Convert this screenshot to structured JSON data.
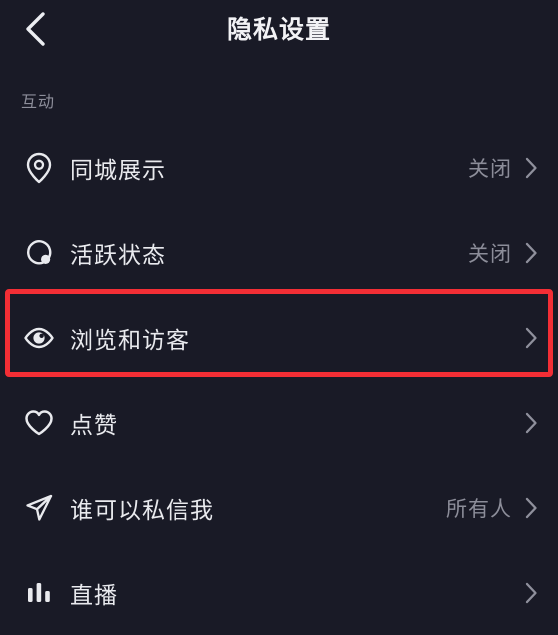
{
  "header": {
    "title": "隐私设置",
    "back_icon": "chevron-left-icon"
  },
  "section": {
    "label": "互动"
  },
  "colors": {
    "background": "#191a26",
    "label_text": "#e9eaee",
    "value_text": "#8c8d99",
    "section_text": "#8d8e9a",
    "highlight": "#f32e35"
  },
  "list": {
    "items": [
      {
        "icon": "location-pin-icon",
        "label": "同城展示",
        "value": "关闭",
        "chevron": "chevron-right-icon",
        "highlighted": false
      },
      {
        "icon": "active-status-icon",
        "label": "活跃状态",
        "value": "关闭",
        "chevron": "chevron-right-icon",
        "highlighted": false
      },
      {
        "icon": "eye-icon",
        "label": "浏览和访客",
        "value": "",
        "chevron": "chevron-right-icon",
        "highlighted": true
      },
      {
        "icon": "heart-icon",
        "label": "点赞",
        "value": "",
        "chevron": "chevron-right-icon",
        "highlighted": false
      },
      {
        "icon": "paper-plane-icon",
        "label": "谁可以私信我",
        "value": "所有人",
        "chevron": "chevron-right-icon",
        "highlighted": false
      },
      {
        "icon": "live-bars-icon",
        "label": "直播",
        "value": "",
        "chevron": "chevron-right-icon",
        "highlighted": false
      }
    ]
  }
}
